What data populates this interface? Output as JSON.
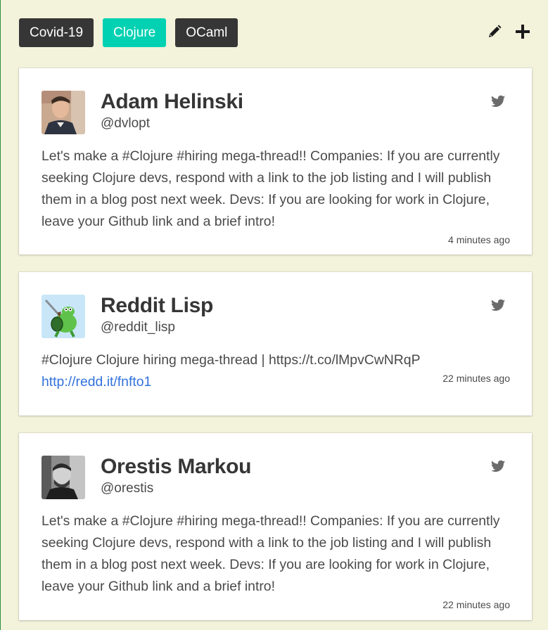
{
  "tabs": [
    {
      "label": "Covid-19",
      "active": false
    },
    {
      "label": "Clojure",
      "active": true
    },
    {
      "label": "OCaml",
      "active": false
    }
  ],
  "toolbar": {
    "edit_icon": "pencil-icon",
    "add_icon": "plus-icon"
  },
  "tweets": [
    {
      "name": "Adam Helinski",
      "handle": "@dvlopt",
      "text": "Let's make a #Clojure #hiring mega-thread!! Companies: If you are currently seeking Clojure devs, respond with a link to the job listing and I will publish them in a blog post next week. Devs: If you are looking for work in Clojure, leave your Github link and a brief intro!",
      "link": "",
      "time": "4 minutes ago"
    },
    {
      "name": "Reddit Lisp",
      "handle": "@reddit_lisp",
      "text": "#Clojure Clojure hiring mega-thread | https://t.co/lMpvCwNRqP",
      "link": "http://redd.it/fnfto1",
      "time": "22 minutes ago"
    },
    {
      "name": "Orestis Markou",
      "handle": "@orestis",
      "text": "Let's make a #Clojure #hiring mega-thread!! Companies: If you are currently seeking Clojure devs, respond with a link to the job listing and I will publish them in a blog post next week. Devs: If you are looking for work in Clojure, leave your Github link and a brief intro!",
      "link": "",
      "time": "22 minutes ago"
    }
  ],
  "colors": {
    "background": "#f3f2db",
    "tab_default": "#363636",
    "tab_active": "#00d1b2",
    "link": "#3273dc"
  }
}
